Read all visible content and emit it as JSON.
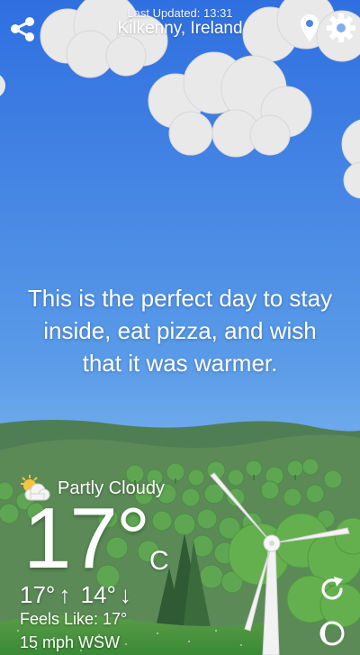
{
  "header": {
    "last_updated": "Last Updated: 13:31",
    "location": "Kilkenny, Ireland"
  },
  "message": "This is the perfect day to stay inside, eat pizza, and wish that it was warmer.",
  "weather": {
    "condition": "Partly Cloudy",
    "condition_icon": "partly-cloudy-icon",
    "temperature": "17°",
    "unit": "C",
    "high": "17°",
    "low": "14°",
    "feels_like": "Feels Like: 17°",
    "wind": "15 mph WSW"
  },
  "icons": {
    "share": "share-icon",
    "location": "location-pin-icon",
    "settings": "gear-icon",
    "refresh": "refresh-icon",
    "moon": "moon-icon"
  },
  "colors": {
    "sky_top": "#2f6fe0",
    "sky_bottom": "#8fc4f2",
    "hills_far": "#4f7e55",
    "grass": "#3f9a3c"
  }
}
